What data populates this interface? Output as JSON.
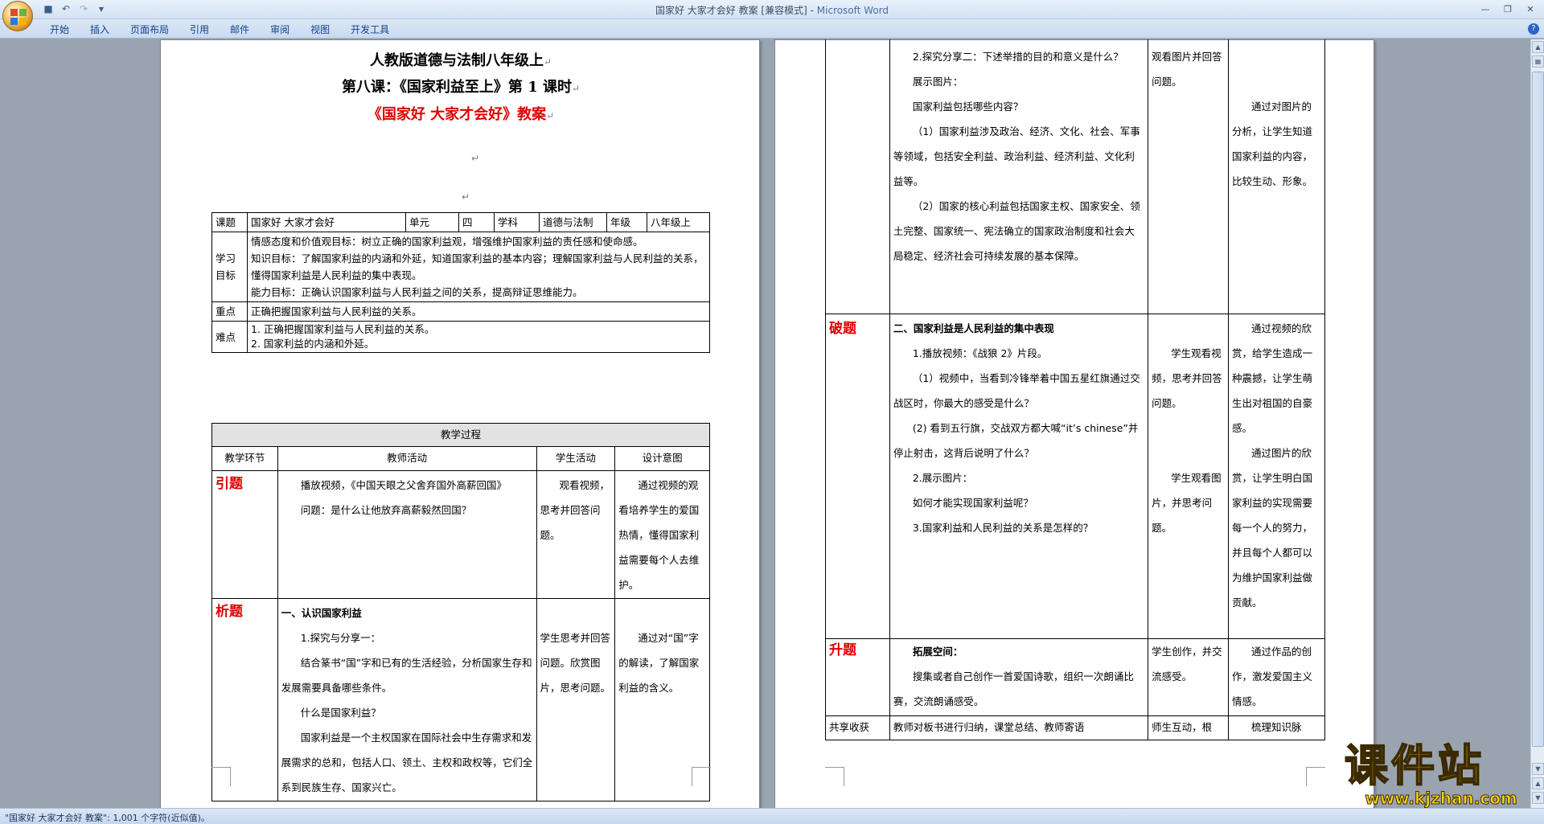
{
  "window": {
    "title": "国家好 大家才会好 教案 [兼容模式] - ",
    "app": "Microsoft Word"
  },
  "ribbon": {
    "tabs": [
      "开始",
      "插入",
      "页面布局",
      "引用",
      "邮件",
      "审阅",
      "视图",
      "开发工具"
    ]
  },
  "status": {
    "text": "\"国家好 大家才会好 教案\": 1,001 个字符(近似值)。"
  },
  "colors": {
    "stage": "#e00000",
    "watermark": "#ffd400"
  },
  "page1": {
    "title1": "人教版道德与法制八年级上",
    "title2": "第八课：《国家利益至上》第 1 课时",
    "title3": "《国家好  大家才会好》教案",
    "info": {
      "k_topic": "课题",
      "v_topic": "国家好 大家才会好",
      "k_unit": "单元",
      "v_unit": "四",
      "k_subject": "学科",
      "v_subject": "道德与法制",
      "k_grade": "年级",
      "v_grade": "八年级上"
    },
    "goals_label": "学习目标",
    "goals": [
      "情感态度和价值观目标：树立正确的国家利益观，增强维护国家利益的责任感和使命感。",
      "知识目标：了解国家利益的内涵和外延，知道国家利益的基本内容；理解国家利益与人民利益的关系，懂得国家利益是人民利益的集中表现。",
      "能力目标：正确认识国家利益与人民利益之间的关系，提高辩证思维能力。"
    ],
    "key_label": "重点",
    "key": "正确把握国家利益与人民利益的关系。",
    "hard_label": "难点",
    "hard": [
      "1. 正确把握国家利益与人民利益的关系。",
      "2. 国家利益的内涵和外延。"
    ],
    "process": "教学过程",
    "headers": [
      "教学环节",
      "教师活动",
      "学生活动",
      "设计意图"
    ],
    "yinti": {
      "stage": "引题",
      "teacher": [
        "播放视频，《中国天眼之父舍弃国外高薪回国》",
        "问题：是什么让他放弃高薪毅然回国？"
      ],
      "student": "观看视频，思考并回答问题。",
      "intent": "通过视频的观看培养学生的爱国热情，懂得国家利益需要每个人去维护。"
    },
    "xiti": {
      "stage": "析题",
      "heading": "一、认识国家利益",
      "teacher": [
        "1.探究与分享一：",
        "结合篆书“国”字和已有的生活经验，分析国家生存和发展需要具备哪些条件。",
        "什么是国家利益？",
        "国家利益是一个主权国家在国际社会中生存需求和发展需求的总和，包括人口、领土、主权和政权等，它们全系到民族生存、国家兴亡。"
      ],
      "student": "学生思考并回答问题。欣赏图片，思考问题。",
      "intent": "通过对“国”字的解读，了解国家利益的含义。"
    }
  },
  "page2": {
    "cont": {
      "teacher": [
        "2.探究分享二：下述举措的目的和意义是什么？",
        "展示图片：",
        "国家利益包括哪些内容？",
        "（1）国家利益涉及政治、经济、文化、社会、军事等领域，包括安全利益、政治利益、经济利益、文化利益等。",
        "（2）国家的核心利益包括国家主权、国家安全、领土完整、国家统一、宪法确立的国家政治制度和社会大局稳定、经济社会可持续发展的基本保障。"
      ],
      "student": "观看图片并回答问题。",
      "intent": "通过对图片的分析，让学生知道国家利益的内容，比较生动、形象。"
    },
    "poti": {
      "stage": "破题",
      "heading": "二、国家利益是人民利益的集中表现",
      "teacher": [
        "1.播放视频：《战狼 2》片段。",
        "（1）视频中，当看到冷锋举着中国五星红旗通过交战区时，你最大的感受是什么？",
        "(2) 看到五行旗，交战双方都大喊“it’s chinese”并停止射击，这背后说明了什么？",
        "2.展示图片：",
        "如何才能实现国家利益呢？",
        "3.国家利益和人民利益的关系是怎样的？"
      ],
      "student1": "学生观看视频，思考并回答问题。",
      "student2": "学生观看图片，并思考问题。",
      "intent1": "通过视频的欣赏，给学生造成一种震撼，让学生萌生出对祖国的自豪感。",
      "intent2": "通过图片的欣赏，让学生明白国家利益的实现需要每一个人的努力，并且每个人都可以为维护国家利益做贡献。"
    },
    "shengti": {
      "stage": "升题",
      "heading": "拓展空间：",
      "teacher": "搜集或者自己创作一首爱国诗歌，组织一次朗诵比赛，交流朗诵感受。",
      "student": "学生创作，并交流感受。",
      "intent": "通过作品的创作，激发爱国主义情感。"
    },
    "share": {
      "stage": "共享收获",
      "teacher": "教师对板书进行归纳，课堂总结、教师寄语",
      "student": "师生互动，根",
      "intent": "梳理知识脉"
    }
  },
  "watermark": {
    "text": "课件站",
    "url": "www.kjzhan.com"
  }
}
